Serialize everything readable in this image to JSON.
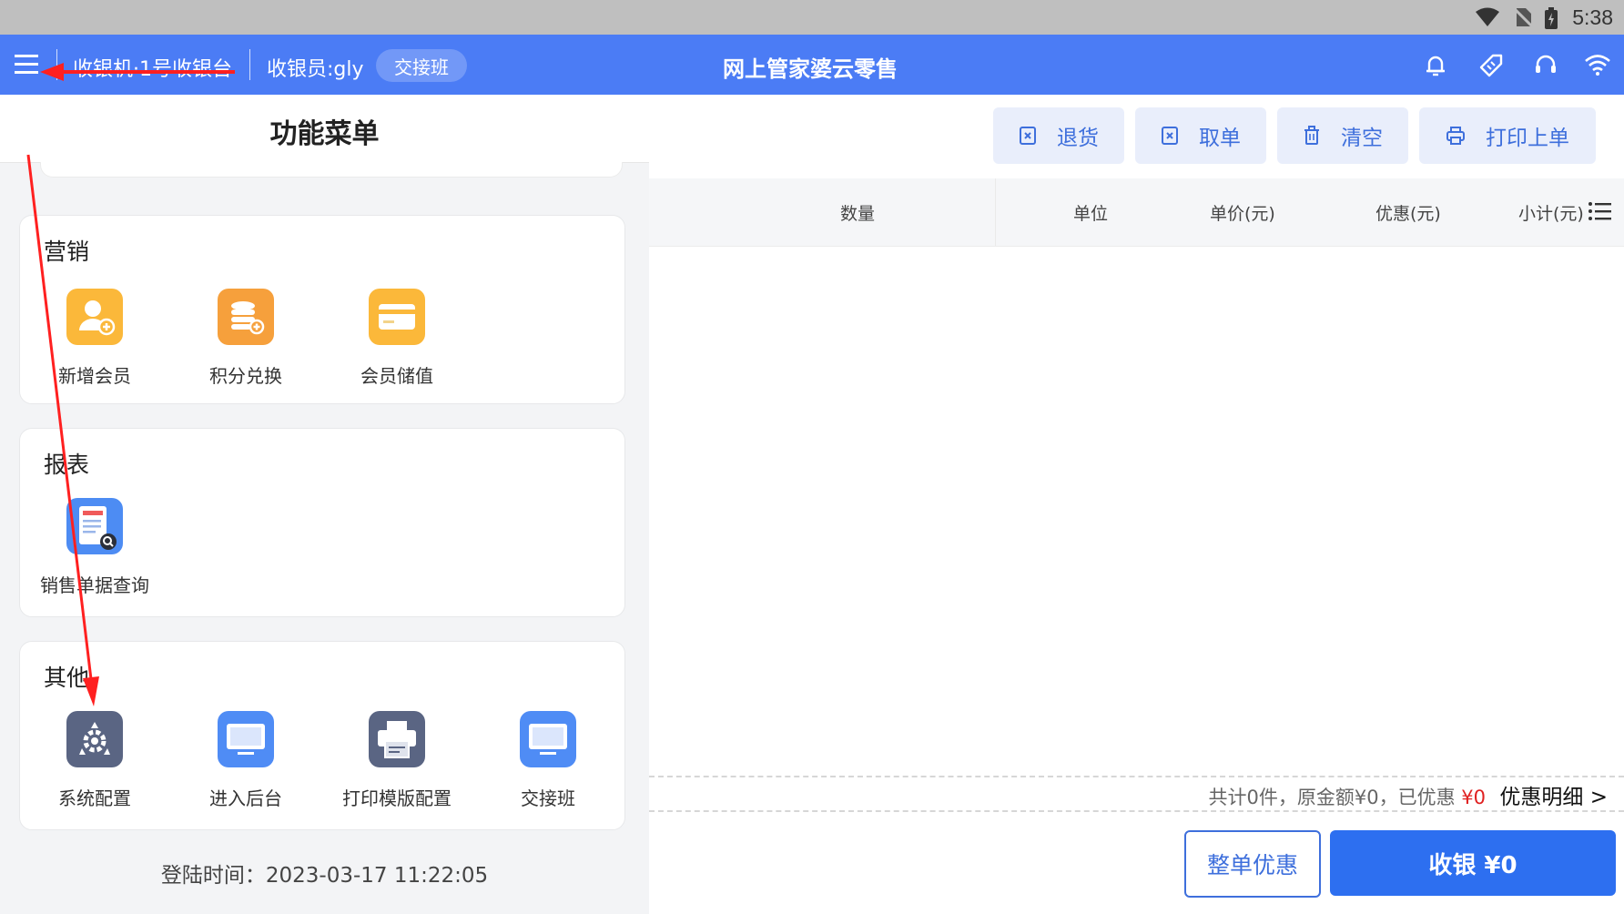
{
  "status": {
    "time": "5:38",
    "icons": [
      "wifi-icon",
      "no-sim-icon",
      "battery-icon"
    ]
  },
  "topbar": {
    "register": "收银机·1号收银台",
    "cashier": "收银员:gly",
    "shift_button": "交接班",
    "app_title": "网上管家婆云零售",
    "icons": [
      "bell-icon",
      "tag-icon",
      "headset-icon",
      "wifi-icon"
    ]
  },
  "menu": {
    "title": "功能菜单",
    "sections": [
      {
        "title": "营销",
        "items": [
          {
            "label": "新增会员",
            "icon": "add-member-icon",
            "color": "#fbb83a"
          },
          {
            "label": "积分兑换",
            "icon": "points-exchange-icon",
            "color": "#f6a03c"
          },
          {
            "label": "会员储值",
            "icon": "member-card-icon",
            "color": "#fbb83a"
          }
        ]
      },
      {
        "title": "报表",
        "items": [
          {
            "label": "销售单据查询",
            "icon": "sales-receipt-search-icon",
            "color": "#4d8cf3"
          }
        ]
      },
      {
        "title": "其他",
        "items": [
          {
            "label": "系统配置",
            "icon": "system-config-icon",
            "color": "#5a6583"
          },
          {
            "label": "进入后台",
            "icon": "backend-monitor-icon",
            "color": "#4f8cf5"
          },
          {
            "label": "打印模版配置",
            "icon": "printer-icon",
            "color": "#5a6583"
          },
          {
            "label": "交接班",
            "icon": "shift-monitor-icon",
            "color": "#4f8cf5"
          }
        ]
      }
    ],
    "login_time": "登陆时间：2023-03-17 11:22:05"
  },
  "toolbar": {
    "return": "退货",
    "take_order": "取单",
    "clear": "清空",
    "print_last": "打印上单"
  },
  "table": {
    "columns": [
      "数量",
      "单位",
      "单价(元)",
      "优惠(元)",
      "小计(元)"
    ]
  },
  "summary": {
    "text": "共计0件，原金额¥0，已优惠",
    "discount": "¥0",
    "detail_link": "优惠明细 >"
  },
  "actions": {
    "whole_discount": "整单优惠",
    "checkout": "收银 ¥0"
  },
  "colors": {
    "primary": "#4b7cf5",
    "button_bg": "#e9eefb",
    "accent_red": "#e02020",
    "annotation_red": "#ff2020"
  }
}
